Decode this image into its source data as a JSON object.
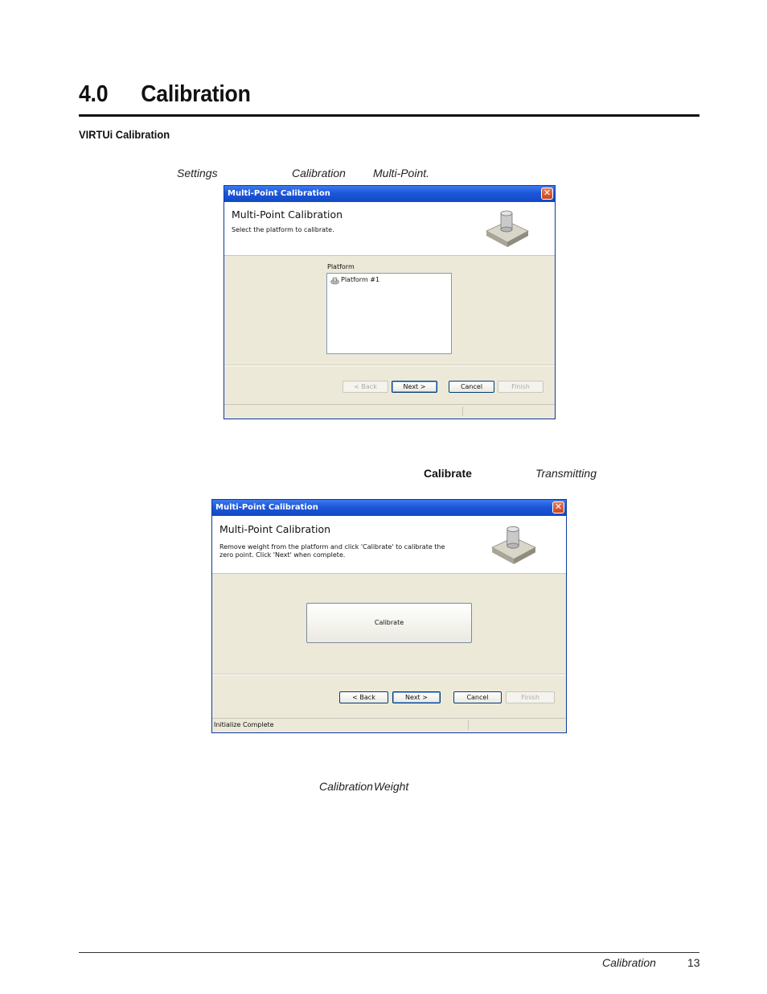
{
  "page": {
    "section_number": "4.0",
    "section_title": "Calibration",
    "subsection_title": "VIRTUi Calibration",
    "line1": {
      "w1": "Settings",
      "w2": "Calibration",
      "w3": "Multi-Point."
    },
    "line2": {
      "w1": "Calibrate",
      "w2": "Transmitting"
    },
    "line3": {
      "w1": "Calibration",
      "w2": "Weight"
    },
    "footer_label": "Calibration",
    "page_number": "13"
  },
  "dialog1": {
    "title": "Multi-Point Calibration",
    "header": "Multi-Point Calibration",
    "instruction": "Select the platform to calibrate.",
    "list_label": "Platform",
    "list_items": [
      "Platform #1"
    ],
    "buttons": {
      "back": "< Back",
      "next": "Next >",
      "cancel": "Cancel",
      "finish": "Finish"
    },
    "status": ""
  },
  "dialog2": {
    "title": "Multi-Point Calibration",
    "header": "Multi-Point Calibration",
    "instruction": "Remove weight from the platform and click 'Calibrate' to calibrate the zero point. Click 'Next' when complete.",
    "calibrate_label": "Calibrate",
    "buttons": {
      "back": "< Back",
      "next": "Next >",
      "cancel": "Cancel",
      "finish": "Finish"
    },
    "status": "Initialize Complete"
  },
  "icons": {
    "close": "close-icon",
    "scale": "scale-platform-icon",
    "platform": "platform-item-icon"
  }
}
